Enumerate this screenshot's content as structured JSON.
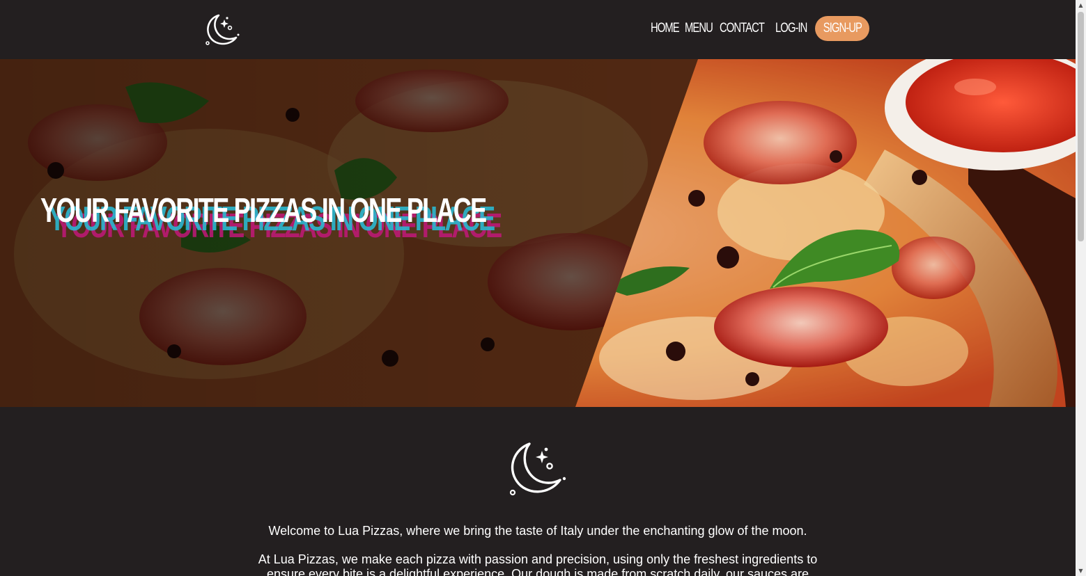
{
  "header": {
    "logo_icon": "moon-stars-icon",
    "nav": {
      "home": "HOME",
      "menu": "MENU",
      "contact": "CONTACT",
      "login": "LOG-IN",
      "signup": "SIGN-UP"
    }
  },
  "hero": {
    "title": "YOUR FAVORITE PIZZAS IN ONE PLACE",
    "image": "pizza-photo"
  },
  "about": {
    "logo_icon": "moon-stars-icon",
    "paragraph1": "Welcome to Lua Pizzas, where we bring the taste of Italy under the enchanting glow of the moon.",
    "paragraph2": "At Lua Pizzas, we make each pizza with passion and precision, using only the freshest ingredients to ensure every bite is a delightful experience. Our dough is made from scratch daily, our sauces are"
  },
  "colors": {
    "background": "#231f20",
    "accent": "#e89a60",
    "title_shadow_cyan": "#2bb8d0",
    "title_shadow_pink": "#c2187a"
  }
}
